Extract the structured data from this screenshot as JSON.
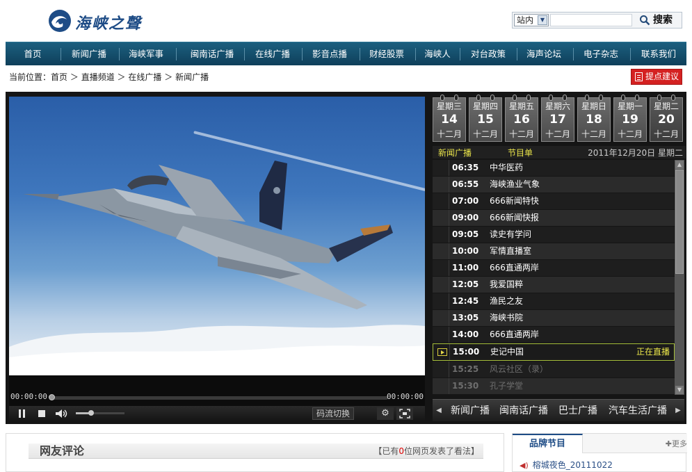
{
  "site": {
    "logo_text": "海峡之聲"
  },
  "search": {
    "scope": "站内",
    "button": "搜索"
  },
  "nav": [
    "首页",
    "新闻广播",
    "海峡军事",
    "闽南话广播",
    "在线广播",
    "影音点播",
    "财经股票",
    "海峡人",
    "对台政策",
    "海声论坛",
    "电子杂志",
    "联系我们"
  ],
  "breadcrumb": {
    "prefix": "当前位置：",
    "items": [
      "首页",
      "直播频道",
      "在线广播",
      "新闻广播"
    ],
    "sep": "＞"
  },
  "suggest_button": "提点建议",
  "player": {
    "time_current": "00:00:00",
    "time_total": "00:00:00",
    "stream_switch": "码流切换",
    "progress_fraction": 0,
    "volume_fraction": 0.3
  },
  "days": [
    {
      "weekday": "星期三",
      "day": "14",
      "month": "十二月"
    },
    {
      "weekday": "星期四",
      "day": "15",
      "month": "十二月"
    },
    {
      "weekday": "星期五",
      "day": "16",
      "month": "十二月"
    },
    {
      "weekday": "星期六",
      "day": "17",
      "month": "十二月"
    },
    {
      "weekday": "星期日",
      "day": "18",
      "month": "十二月"
    },
    {
      "weekday": "星期一",
      "day": "19",
      "month": "十二月"
    },
    {
      "weekday": "星期二",
      "day": "20",
      "month": "十二月"
    }
  ],
  "schedule": {
    "channel": "新闻广播",
    "title": "节目单",
    "date": "2011年12月20日  星期二",
    "live_label": "正在直播",
    "items": [
      {
        "time": "06:35",
        "name": "中华医药",
        "state": "past"
      },
      {
        "time": "06:55",
        "name": "海峡渔业气象",
        "state": "past"
      },
      {
        "time": "07:00",
        "name": "666新闻特快",
        "state": "past"
      },
      {
        "time": "09:00",
        "name": "666新闻快报",
        "state": "past"
      },
      {
        "time": "09:05",
        "name": "读史有学问",
        "state": "past"
      },
      {
        "time": "10:00",
        "name": "军情直播室",
        "state": "past"
      },
      {
        "time": "11:00",
        "name": "666直通两岸",
        "state": "past"
      },
      {
        "time": "12:05",
        "name": "我爱国粹",
        "state": "past"
      },
      {
        "time": "12:45",
        "name": "渔民之友",
        "state": "past"
      },
      {
        "time": "13:05",
        "name": "海峡书院",
        "state": "past"
      },
      {
        "time": "14:00",
        "name": "666直通两岸",
        "state": "past"
      },
      {
        "time": "15:00",
        "name": "史记中国",
        "state": "live"
      },
      {
        "time": "15:25",
        "name": "风云社区（录）",
        "state": "future"
      },
      {
        "time": "15:30",
        "name": "孔子学堂",
        "state": "future"
      }
    ]
  },
  "channels": [
    "新闻广播",
    "闽南话广播",
    "巴士广播",
    "汽车生活广播"
  ],
  "comments": {
    "title": "网友评论",
    "count_prefix": "【已有",
    "count": "0",
    "count_suffix": "位网页发表了看法】"
  },
  "brand": {
    "tab": "品牌节目",
    "more": "更多",
    "items": [
      "榕城夜色_20111022"
    ]
  },
  "colors": {
    "nav": "#0e3f5a",
    "accent": "#d42121",
    "live_border": "#a7c03c",
    "schedule_highlight": "#e9e44a",
    "brand_blue": "#1e4c86"
  }
}
